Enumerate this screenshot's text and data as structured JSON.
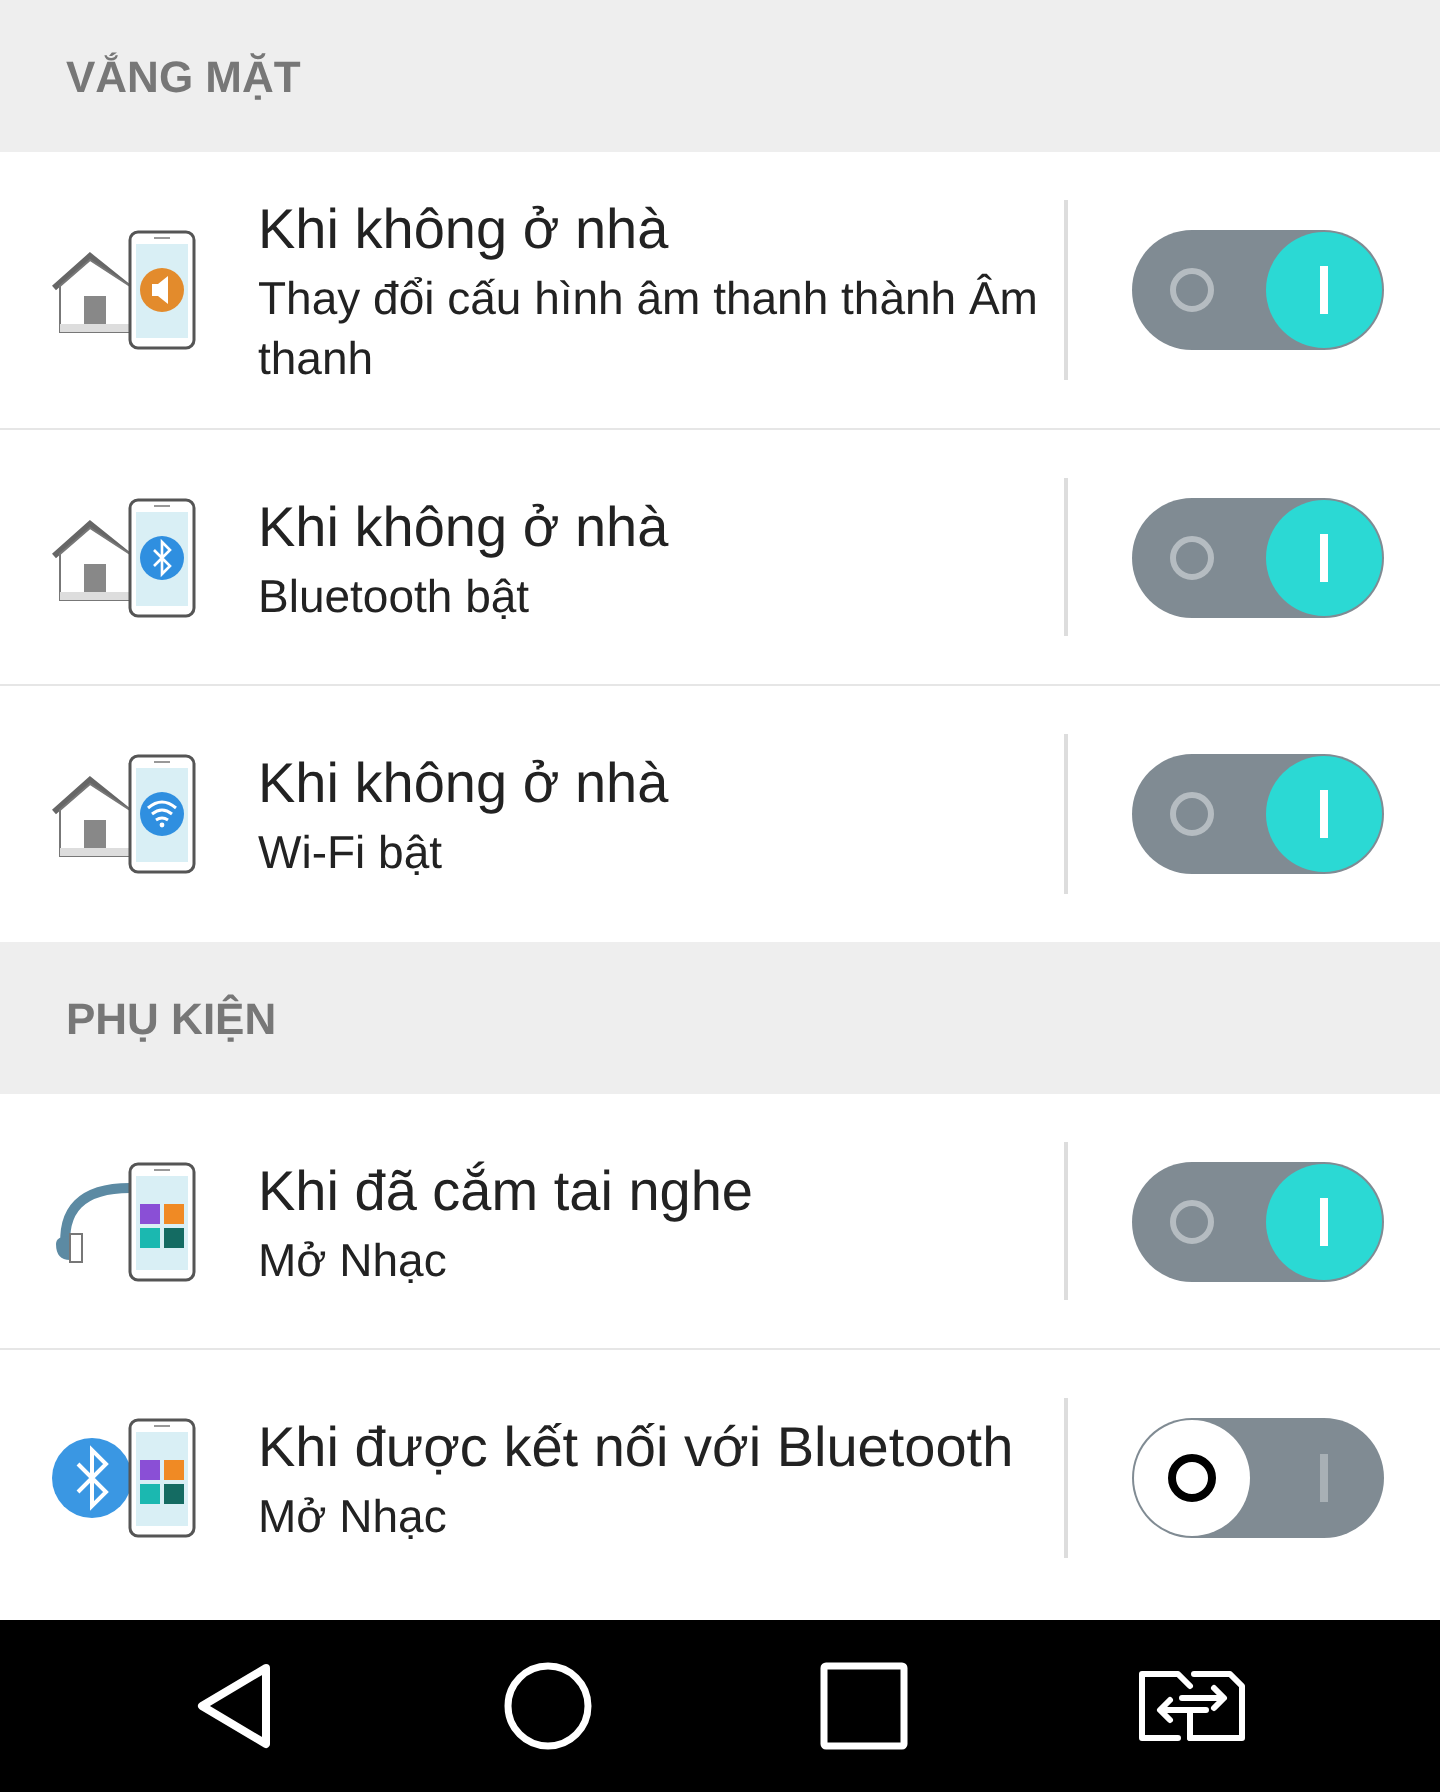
{
  "sections": [
    {
      "header": "VẮNG MẶT",
      "rows": [
        {
          "title": "Khi không ở nhà",
          "subtitle": "Thay đổi cấu hình âm thanh thành Âm thanh",
          "on": true
        },
        {
          "title": "Khi không ở nhà",
          "subtitle": "Bluetooth bật",
          "on": true
        },
        {
          "title": "Khi không ở nhà",
          "subtitle": "Wi-Fi bật",
          "on": true
        }
      ]
    },
    {
      "header": "PHỤ KIỆN",
      "rows": [
        {
          "title": "Khi đã cắm tai nghe",
          "subtitle": "Mở Nhạc",
          "on": true
        },
        {
          "title": "Khi được kết nối với Bluetooth",
          "subtitle": "Mở Nhạc",
          "on": false
        }
      ]
    }
  ]
}
